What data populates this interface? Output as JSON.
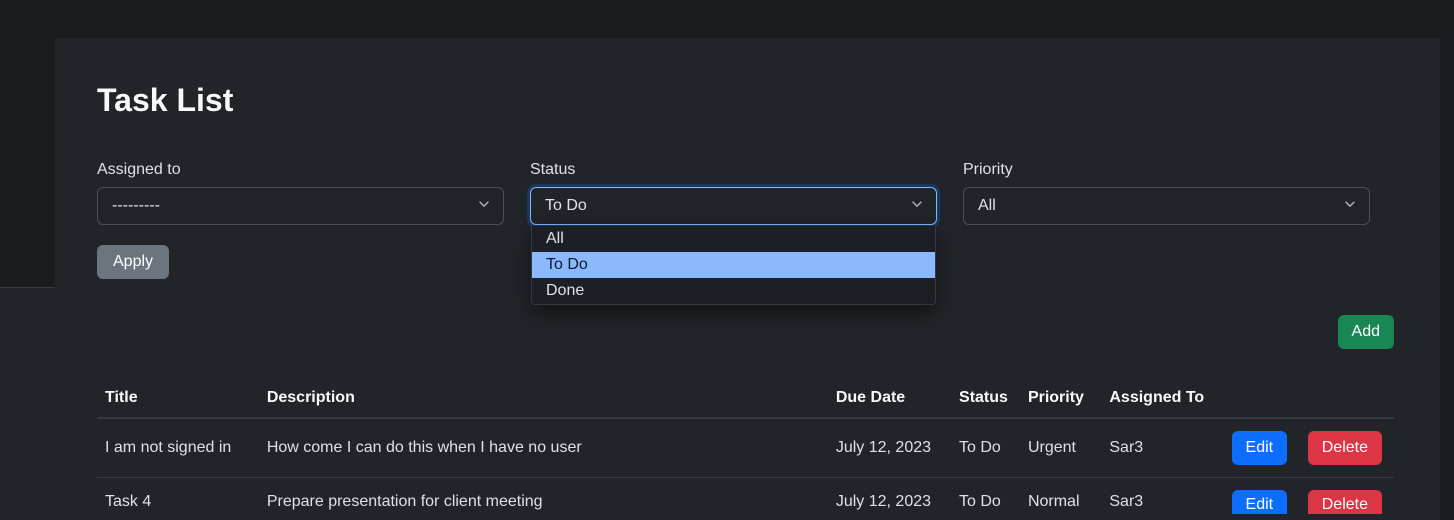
{
  "page": {
    "title": "Task List"
  },
  "filters": {
    "assigned": {
      "label": "Assigned to",
      "selected": "---------"
    },
    "status": {
      "label": "Status",
      "selected": "To Do",
      "options": [
        "All",
        "To Do",
        "Done"
      ],
      "highlighted_index": 1
    },
    "priority": {
      "label": "Priority",
      "selected": "All"
    },
    "apply_label": "Apply"
  },
  "actions": {
    "add_label": "Add"
  },
  "table": {
    "headers": {
      "title": "Title",
      "description": "Description",
      "due": "Due Date",
      "status": "Status",
      "priority": "Priority",
      "assigned": "Assigned To"
    },
    "rows": [
      {
        "title": "I am not signed in",
        "description": "How come I can do this when I have no user",
        "due": "July 12, 2023",
        "status": "To Do",
        "priority": "Urgent",
        "assigned": "Sar3",
        "edit_label": "Edit",
        "delete_label": "Delete"
      },
      {
        "title": "Task 4",
        "description": "Prepare presentation for client meeting",
        "due": "July 12, 2023",
        "status": "To Do",
        "priority": "Normal",
        "assigned": "Sar3",
        "edit_label": "Edit",
        "delete_label": "Delete"
      }
    ]
  }
}
